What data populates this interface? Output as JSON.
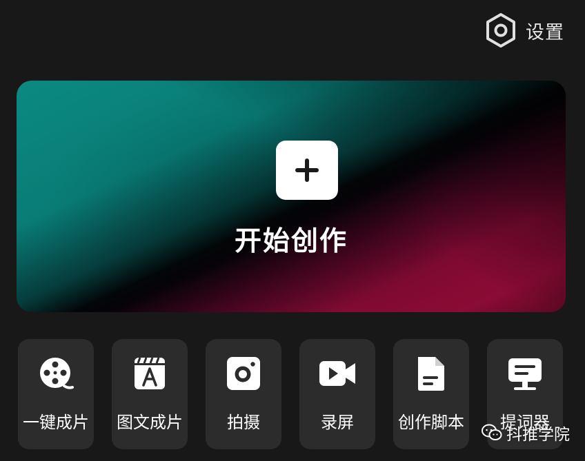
{
  "header": {
    "settings_label": "设置",
    "settings_icon": "hexagon-gear-icon"
  },
  "hero": {
    "label": "开始创作",
    "icon": "plus-icon",
    "colors": {
      "teal": "#0b8a82",
      "crimson": "#8a0b35"
    }
  },
  "tools": [
    {
      "label": "一键成片",
      "icon": "film-reel-icon"
    },
    {
      "label": "图文成片",
      "icon": "text-clapper-icon"
    },
    {
      "label": "拍摄",
      "icon": "camera-icon"
    },
    {
      "label": "录屏",
      "icon": "video-record-icon"
    },
    {
      "label": "创作脚本",
      "icon": "document-icon"
    },
    {
      "label": "提词器",
      "icon": "teleprompter-icon"
    }
  ],
  "watermark": {
    "text": "抖推学院",
    "icon": "wechat-icon"
  }
}
